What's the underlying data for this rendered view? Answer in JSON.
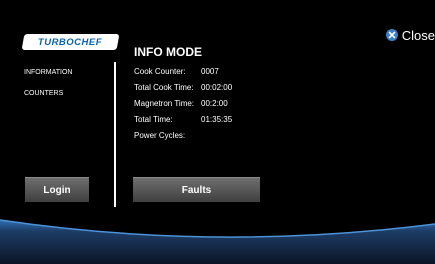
{
  "brand": {
    "logo_text": "TURBOCHEF"
  },
  "header": {
    "title": "INFO MODE",
    "close_label": "Close"
  },
  "nav": {
    "items": [
      {
        "label": "INFORMATION"
      },
      {
        "label": "COUNTERS"
      }
    ]
  },
  "counters": [
    {
      "label": "Cook Counter:",
      "value": "0007"
    },
    {
      "label": "Total Cook Time:",
      "value": "00:02:00"
    },
    {
      "label": "Magnetron Time:",
      "value": "00:2:00"
    },
    {
      "label": "Total Time:",
      "value": "01:35:35"
    },
    {
      "label": "Power Cycles:",
      "value": ""
    }
  ],
  "buttons": {
    "login": "Login",
    "faults": "Faults"
  },
  "icons": {
    "close": "close-x-circle-icon"
  },
  "colors": {
    "accent": "#3b7fc4",
    "logo_text": "#0b63b3",
    "background": "#000000",
    "wave_light": "#2f6fb4",
    "wave_dark": "#15243b"
  }
}
